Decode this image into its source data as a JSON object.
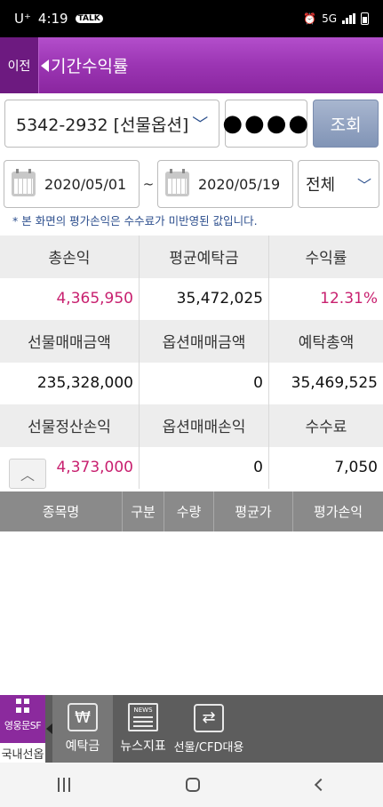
{
  "status": {
    "carrier": "U⁺",
    "time": "4:19",
    "talk": "TALK",
    "network": "5G"
  },
  "header": {
    "back_label": "이전",
    "title": "기간수익률"
  },
  "account": {
    "selected": "5342-2932 [선물옵션]",
    "password_mask": "●●●●",
    "query_label": "조회"
  },
  "dates": {
    "from": "2020/05/01",
    "separator": "~",
    "to": "2020/05/19",
    "filter": "전체"
  },
  "notice": "* 본 화면의 평가손익은 수수료가 미반영된 값입니다.",
  "summary": {
    "row1_heads": [
      "총손익",
      "평균예탁금",
      "수익률"
    ],
    "row1_vals": [
      "4,365,950",
      "35,472,025",
      "12.31%"
    ],
    "row2_heads": [
      "선물매매금액",
      "옵션매매금액",
      "예탁총액"
    ],
    "row2_vals": [
      "235,328,000",
      "0",
      "35,469,525"
    ],
    "row3_heads": [
      "선물정산손익",
      "옵션매매손익",
      "수수료"
    ],
    "row3_vals": [
      "4,373,000",
      "0",
      "7,050"
    ]
  },
  "table": {
    "columns": [
      "종목명",
      "구분",
      "수량",
      "평균가",
      "평가손익"
    ]
  },
  "bottom_menu": {
    "brand": "영웅문SF",
    "brand_sub": "국내선옵",
    "items": [
      {
        "label": "예탁금",
        "icon": "won-icon"
      },
      {
        "label": "뉴스지표",
        "icon": "news-icon"
      },
      {
        "label": "선물/CFD대용",
        "icon": "document-exchange-icon"
      }
    ],
    "news_badge": "NEWS"
  },
  "colors": {
    "header": "#9b35b3",
    "profit_red": "#c8206f",
    "query_button": "#8194b6",
    "table_header": "#8a8a8a"
  }
}
